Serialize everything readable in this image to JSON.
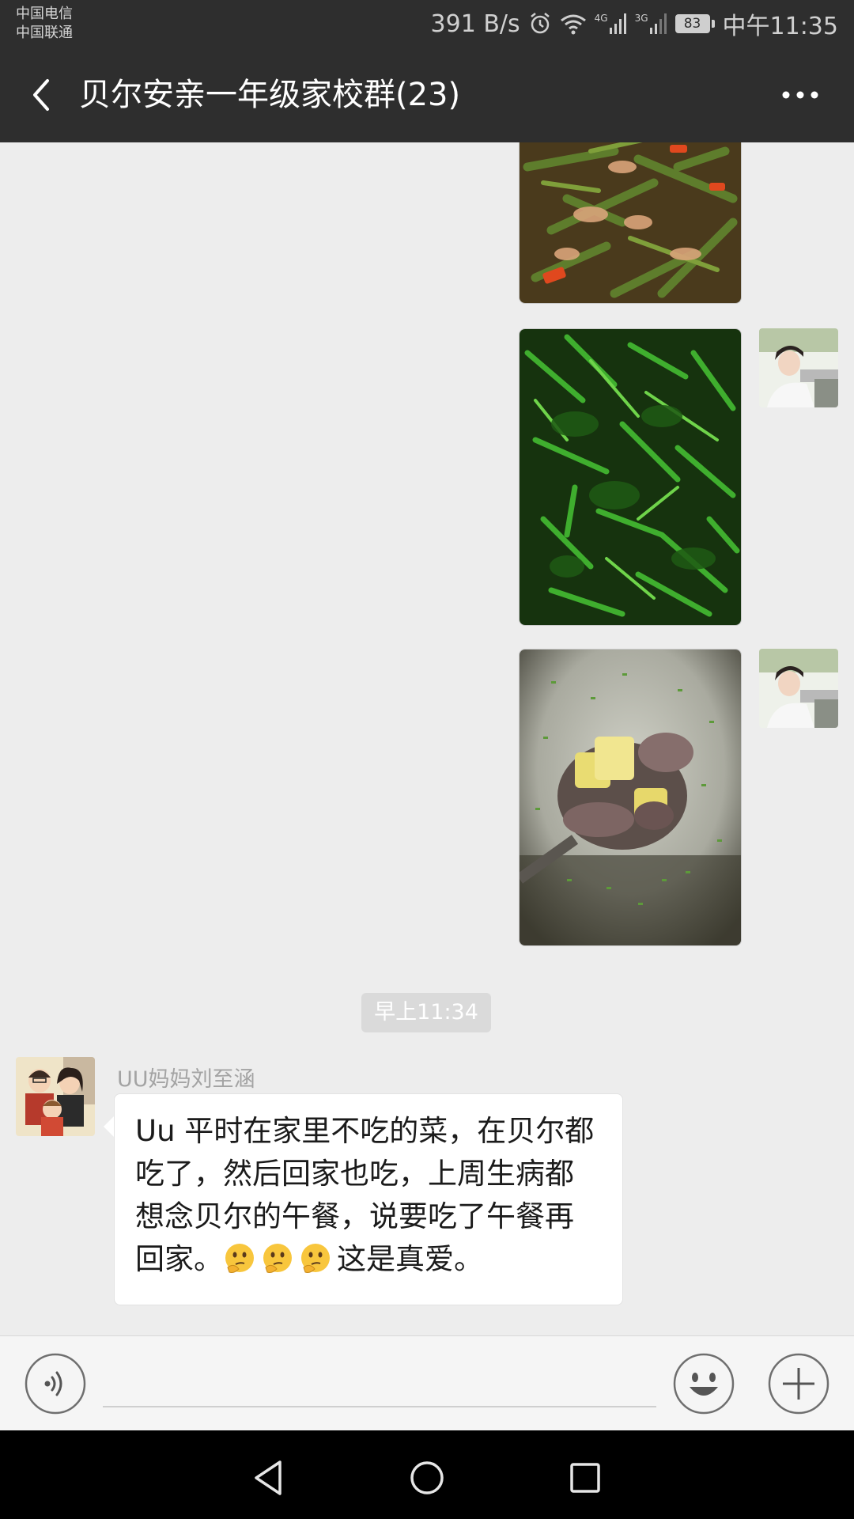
{
  "status_bar": {
    "carrier_1": "中国电信",
    "carrier_2": "中国联通",
    "network_speed": "391 B/s",
    "signal_1_type": "4G",
    "signal_2_type": "3G",
    "battery_level": "83",
    "time": "中午11:35"
  },
  "header": {
    "title": "贝尔安亲一年级家校群(23)",
    "back_icon": "chevron-left-icon",
    "more_icon": "more-dots-icon"
  },
  "messages": {
    "timestamp": "早上11:34",
    "incoming": {
      "sender": "UU妈妈刘至涵",
      "text_1": "Uu 平时在家里不吃的菜，在贝尔都吃了，然后回家也吃，上周生病都想念贝尔的午餐，说要吃了午餐再回家。",
      "emoji": "thinking-face-icon",
      "emoji_count": 3,
      "text_2": "这是真爱。"
    },
    "photos": [
      {
        "subject": "green-beans-stir-fry"
      },
      {
        "subject": "spinach"
      },
      {
        "subject": "soup-with-potato-and-meat"
      }
    ]
  },
  "input_bar": {
    "placeholder": "",
    "voice_icon": "voice-icon",
    "emoji_icon": "emoji-icon",
    "plus_icon": "plus-icon"
  },
  "nav": {
    "back": "nav-back-icon",
    "home": "nav-home-icon",
    "recents": "nav-recents-icon"
  },
  "colors": {
    "header_bg": "#2e2e2e",
    "chat_bg": "#ededed",
    "bubble_bg": "#ffffff"
  }
}
